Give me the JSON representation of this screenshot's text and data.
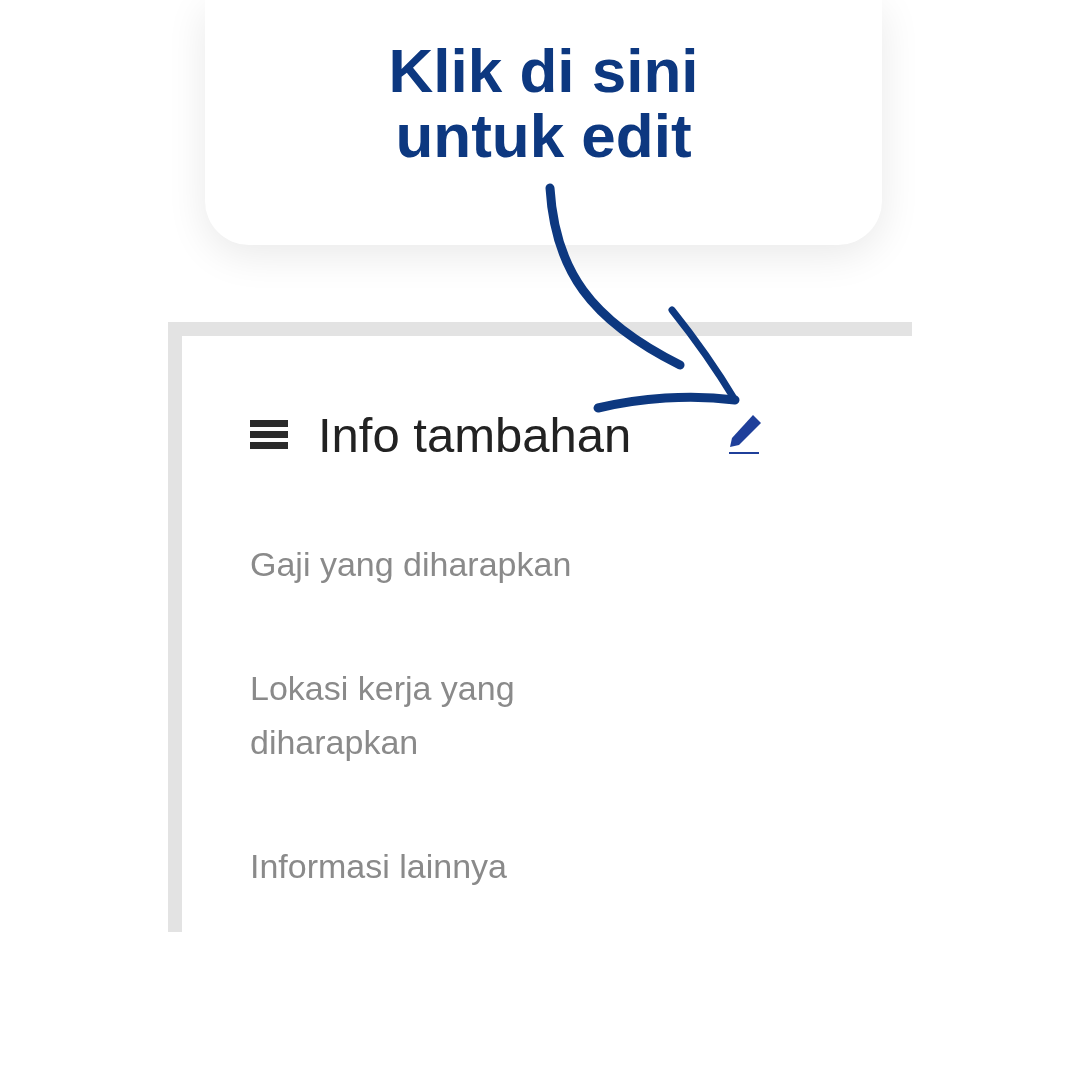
{
  "callout": {
    "text": "Klik di sini untuk edit"
  },
  "panel": {
    "title": "Info tambahan",
    "items": [
      {
        "label": "Gaji yang diharapkan"
      },
      {
        "label": "Lokasi kerja yang diharapkan"
      },
      {
        "label": "Informasi lainnya"
      }
    ]
  }
}
